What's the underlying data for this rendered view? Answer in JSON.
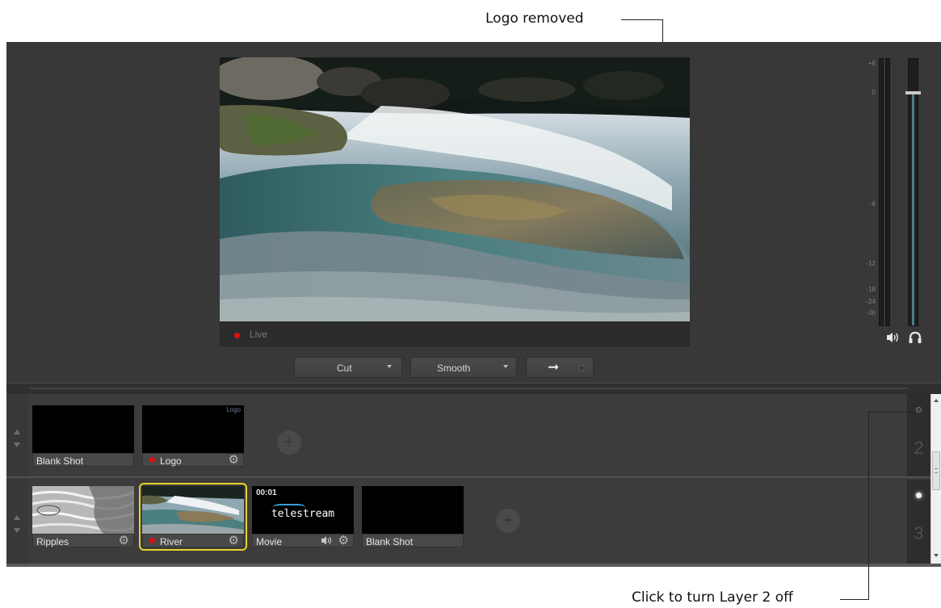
{
  "callouts": {
    "top": "Logo removed",
    "bottom": "Click to turn Layer 2 off"
  },
  "preview": {
    "live_label": "Live",
    "live_color": "#e01010"
  },
  "transitions": {
    "cut_label": "Cut",
    "smooth_label": "Smooth",
    "take_icon": "right-arrow-icon"
  },
  "meter": {
    "ticks": [
      "+6",
      "0",
      "-6",
      "-12",
      "-18",
      "-24",
      "-36"
    ],
    "icons": [
      "speaker-icon",
      "headphone-icon"
    ],
    "fill_color": "#4b7d86"
  },
  "layers": [
    {
      "number": "2",
      "state": "off",
      "shots": [
        {
          "name": "Blank Shot",
          "live": false,
          "settings": false
        },
        {
          "name": "Logo",
          "live": true,
          "settings": true,
          "thumb_text": "Logo"
        }
      ]
    },
    {
      "number": "3",
      "state": "on",
      "shots": [
        {
          "name": "Ripples",
          "live": false,
          "settings": true
        },
        {
          "name": "River",
          "live": true,
          "settings": true,
          "selected": true
        },
        {
          "name": "Movie",
          "live": false,
          "settings": true,
          "volume": true,
          "thumb_time": "00:01",
          "thumb_brand": "telestream"
        },
        {
          "name": "Blank Shot",
          "live": false,
          "settings": false
        }
      ]
    }
  ],
  "selection_color": "#e6d22a"
}
